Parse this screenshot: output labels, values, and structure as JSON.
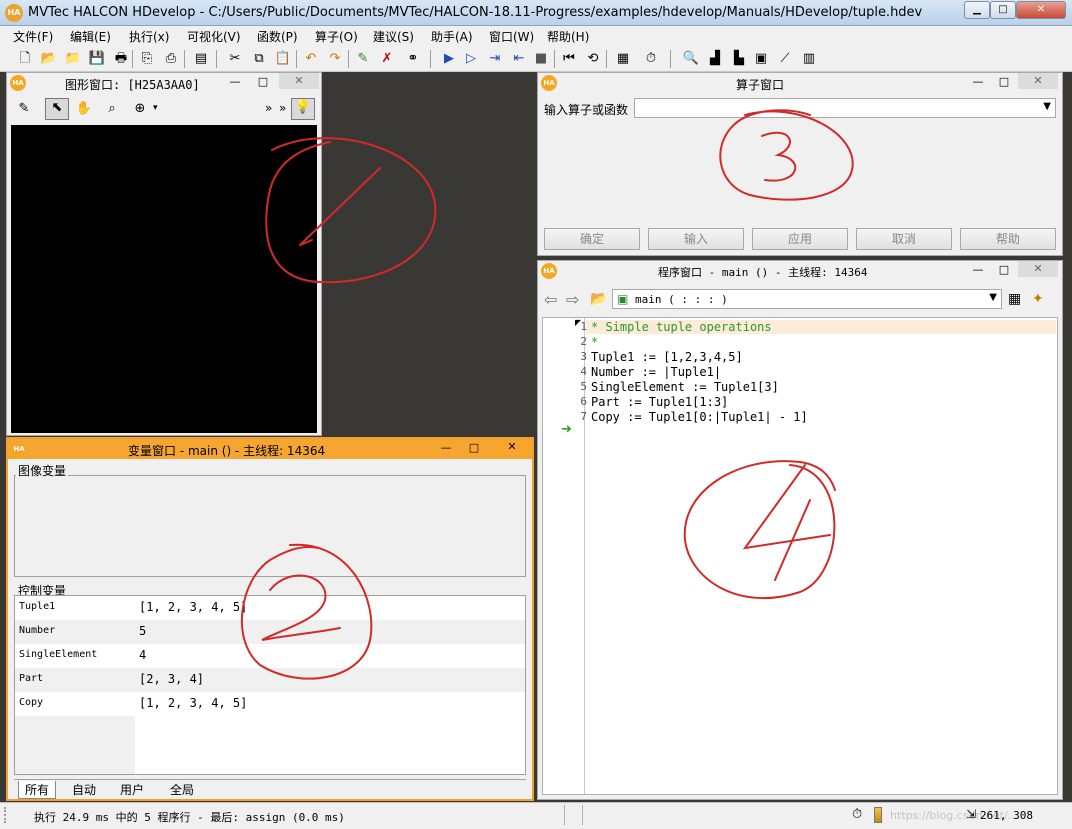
{
  "window": {
    "title": "MVTec HALCON HDevelop - C:/Users/Public/Documents/MVTec/HALCON-18.11-Progress/examples/hdevelop/Manuals/HDevelop/tuple.hdev",
    "logo": "HA",
    "min": "▁",
    "max": "□",
    "close": "✕"
  },
  "menu": [
    "文件(F)",
    "编辑(E)",
    "执行(x)",
    "可视化(V)",
    "函数(P)",
    "算子(O)",
    "建议(S)",
    "助手(A)",
    "窗口(W)",
    "帮助(H)"
  ],
  "graphics_window": {
    "title": "图形窗口: [H25A3AA0]",
    "chevron": "»",
    "min": "—",
    "max": "□",
    "close": "✕"
  },
  "variable_window": {
    "title": "变量窗口 - main () - 主线程: 14364",
    "image_vars_label": "图像变量",
    "control_vars_label": "控制变量",
    "rows": [
      {
        "name": "Tuple1",
        "value": "[1, 2, 3, 4, 5]"
      },
      {
        "name": "Number",
        "value": "5"
      },
      {
        "name": "SingleElement",
        "value": "4"
      },
      {
        "name": "Part",
        "value": "[2, 3, 4]"
      },
      {
        "name": "Copy",
        "value": "[1, 2, 3, 4, 5]"
      }
    ],
    "tabs": [
      "所有",
      "自动",
      "用户",
      "全局"
    ],
    "min": "—",
    "max": "□",
    "close": "✕"
  },
  "operator_window": {
    "title": "算子窗口",
    "input_label": "输入算子或函数",
    "buttons": [
      "确定",
      "输入",
      "应用",
      "取消",
      "帮助"
    ],
    "min": "—",
    "max": "□",
    "close": "✕"
  },
  "program_window": {
    "title": "程序窗口 - main () - 主线程: 14364",
    "procedure": "main ( : : : )",
    "lines": [
      {
        "num": "1",
        "text": "* Simple tuple operations",
        "comment": true
      },
      {
        "num": "2",
        "text": "*",
        "comment": true
      },
      {
        "num": "3",
        "text": "Tuple1 := [1,2,3,4,5]",
        "comment": false
      },
      {
        "num": "4",
        "text": "Number := |Tuple1|",
        "comment": false
      },
      {
        "num": "5",
        "text": "SingleElement := Tuple1[3]",
        "comment": false
      },
      {
        "num": "6",
        "text": "Part := Tuple1[1:3]",
        "comment": false
      },
      {
        "num": "7",
        "text": "Copy := Tuple1[0:|Tuple1| - 1]",
        "comment": false
      }
    ],
    "min": "—",
    "max": "□",
    "close": "✕"
  },
  "status": {
    "text": "执行 24.9 ms 中的 5 程序行 - 最后: assign (0.0 ms)",
    "watermark": "https://blog.csdn.net/...",
    "coords": "261, 308"
  },
  "annotations": {
    "color": "#d22a2a",
    "labels": [
      "1",
      "2",
      "3",
      "4"
    ]
  }
}
